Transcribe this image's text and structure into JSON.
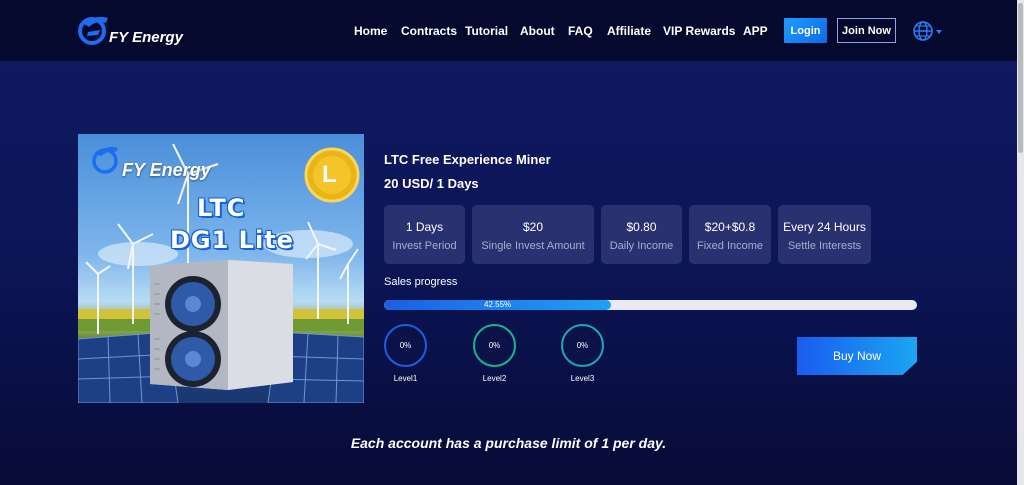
{
  "brand": {
    "name": "FY Energy"
  },
  "nav": {
    "items": [
      {
        "label": "Home"
      },
      {
        "label": "Contracts"
      },
      {
        "label": "Tutorial"
      },
      {
        "label": "About"
      },
      {
        "label": "FAQ"
      },
      {
        "label": "Affiliate"
      },
      {
        "label": "VIP Rewards"
      },
      {
        "label": "APP"
      }
    ],
    "login_label": "Login",
    "join_label": "Join Now",
    "language_icon": "globe-icon"
  },
  "product": {
    "image": {
      "brand": "FY Energy",
      "model_line1": "LTC",
      "model_line2": "DG1 Lite",
      "coin": "L"
    },
    "title": "LTC Free Experience Miner",
    "price_line": "20 USD/ 1 Days",
    "stats": [
      {
        "value": "1 Days",
        "label": "Invest Period"
      },
      {
        "value": "$20",
        "label": "Single Invest Amount"
      },
      {
        "value": "$0.80",
        "label": "Daily Income"
      },
      {
        "value": "$20+$0.8",
        "label": "Fixed Income"
      },
      {
        "value": "Every 24 Hours",
        "label": "Settle Interests"
      }
    ],
    "sales_label": "Sales progress",
    "sales_progress_text": "42.55%",
    "sales_progress": 42.55,
    "levels": [
      {
        "value": "0%",
        "label": "Level1"
      },
      {
        "value": "0%",
        "label": "Level2"
      },
      {
        "value": "0%",
        "label": "Level3"
      }
    ],
    "buy_label": "Buy Now"
  },
  "notice": "Each account has a purchase limit of 1 per day.",
  "colors": {
    "accent": "#1a6df0",
    "background": "#0c1556",
    "header": "#06092e"
  }
}
